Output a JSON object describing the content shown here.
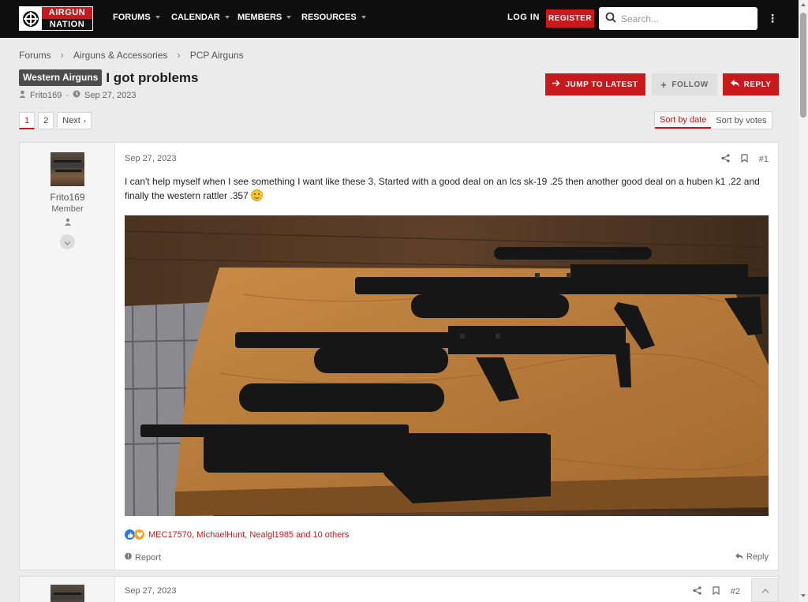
{
  "header": {
    "logo_line1": "AIRGUN",
    "logo_line2": "NATION",
    "nav": [
      {
        "label": "FORUMS"
      },
      {
        "label": "CALENDAR"
      },
      {
        "label": "MEMBERS"
      },
      {
        "label": "RESOURCES"
      }
    ],
    "login_label": "LOG IN",
    "register_label": "REGISTER",
    "search_placeholder": "Search..."
  },
  "breadcrumb": [
    "Forums",
    "Airguns & Accessories",
    "PCP Airguns"
  ],
  "thread": {
    "prefix": "Western Airguns",
    "title": "I got problems",
    "author": "Frito169",
    "date": "Sep 27, 2023"
  },
  "actions": {
    "jump_label": "JUMP TO LATEST",
    "follow_label": "FOLLOW",
    "reply_label": "REPLY"
  },
  "pagination": {
    "pages": [
      "1",
      "2"
    ],
    "current": "1",
    "next_label": "Next"
  },
  "sort": {
    "options": [
      "Sort by date",
      "Sort by votes"
    ],
    "active": "Sort by date"
  },
  "posts": [
    {
      "username": "Frito169",
      "user_title": "Member",
      "date": "Sep 27, 2023",
      "number": "#1",
      "text": "I can't help myself when I see something I want like these 3. Started with a good deal on an lcs sk-19 .25 then another good deal on a huben k1 .22 and finally the western rattler .357",
      "reactors": "MEC17570, MichaelHunt, Nealgl1985 and 10 others",
      "report_label": "Report",
      "reply_label": "Reply"
    },
    {
      "date": "Sep 27, 2023",
      "number": "#2"
    }
  ],
  "icons": [
    "search-icon",
    "share-icon",
    "bookmark-icon",
    "user-icon",
    "clock-icon",
    "chevron-down-icon",
    "like-icon",
    "love-icon",
    "report-icon",
    "reply-icon",
    "arrow-right-icon",
    "plus-icon",
    "reply-arrow-icon",
    "more-icon",
    "chevron-up-icon"
  ],
  "colors": {
    "brand_red": "#c8191c",
    "topbar": "#0f0f0f",
    "page_bg": "#ebebeb"
  }
}
